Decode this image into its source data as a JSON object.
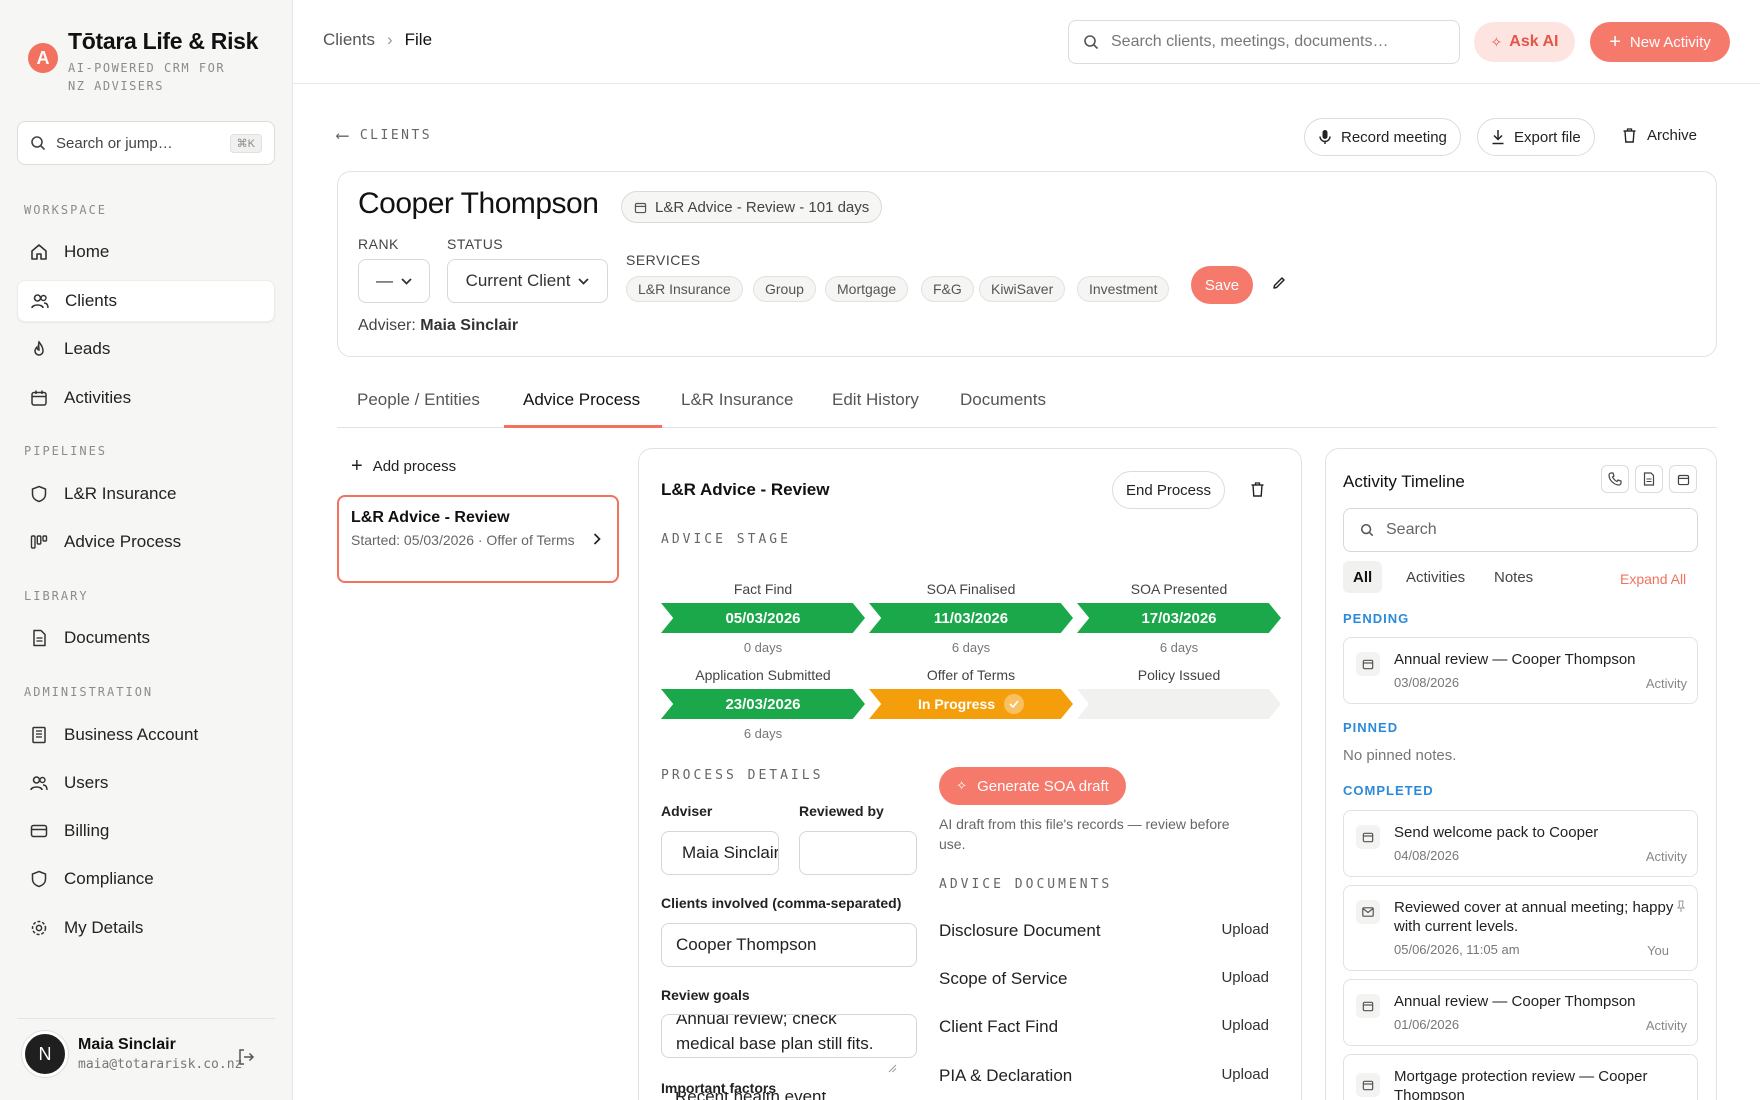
{
  "brand": {
    "logo_letter": "A",
    "title": "Tōtara Life & Risk",
    "subtitle": "AI-POWERED CRM FOR NZ ADVISERS"
  },
  "sidebar": {
    "search_placeholder": "Search or jump…",
    "search_shortcut": "⌘K",
    "sections": {
      "workspace": "WORKSPACE",
      "pipelines": "PIPELINES",
      "library": "LIBRARY",
      "administration": "ADMINISTRATION"
    },
    "items": {
      "home": "Home",
      "clients": "Clients",
      "leads": "Leads",
      "activities": "Activities",
      "lr_insurance": "L&R Insurance",
      "advice_process": "Advice Process",
      "documents": "Documents",
      "business_account": "Business Account",
      "users": "Users",
      "billing": "Billing",
      "compliance": "Compliance",
      "my_details": "My Details"
    },
    "user": {
      "initial": "N",
      "name": "Maia Sinclair",
      "email": "maia@totararisk.co.nz"
    }
  },
  "topbar": {
    "breadcrumb_root": "Clients",
    "breadcrumb_sep": "›",
    "breadcrumb_current": "File",
    "search_placeholder": "Search clients, meetings, documents…",
    "ask_ai": "Ask AI",
    "new_activity": "New Activity"
  },
  "page": {
    "back_label": "CLIENTS",
    "record_meeting": "Record meeting",
    "export_file": "Export file",
    "archive": "Archive"
  },
  "client": {
    "name": "Cooper Thompson",
    "process_badge": "L&R Advice - Review - 101 days",
    "rank_label": "RANK",
    "rank_value": "—",
    "status_label": "STATUS",
    "status_value": "Current Client",
    "services_label": "SERVICES",
    "services": [
      "L&R Insurance",
      "Group",
      "Mortgage",
      "F&G",
      "KiwiSaver",
      "Investment"
    ],
    "save": "Save",
    "adviser_prefix": "Adviser:",
    "adviser_name": "Maia Sinclair"
  },
  "tabs": [
    "People / Entities",
    "Advice Process",
    "L&R Insurance",
    "Edit History",
    "Documents"
  ],
  "processes": {
    "add_label": "Add process",
    "items": [
      {
        "title": "L&R Advice - Review",
        "subtitle": "Started: 05/03/2026 · Offer of Terms"
      }
    ]
  },
  "process_panel": {
    "title": "L&R Advice - Review",
    "end_process": "End Process",
    "advice_stage_cap": "ADVICE STAGE",
    "stages": [
      {
        "label": "Fact Find",
        "value": "05/03/2026",
        "days": "0 days",
        "state": "done"
      },
      {
        "label": "SOA Finalised",
        "value": "11/03/2026",
        "days": "6 days",
        "state": "done"
      },
      {
        "label": "SOA Presented",
        "value": "17/03/2026",
        "days": "6 days",
        "state": "done"
      },
      {
        "label": "Application Submitted",
        "value": "23/03/2026",
        "days": "6 days",
        "state": "done"
      },
      {
        "label": "Offer of Terms",
        "value": "In Progress",
        "days": "",
        "state": "progress"
      },
      {
        "label": "Policy Issued",
        "value": "",
        "days": "",
        "state": "empty"
      }
    ],
    "process_details_cap": "PROCESS DETAILS",
    "adviser_label": "Adviser",
    "adviser_value": "Maia Sinclair",
    "reviewed_by_label": "Reviewed by",
    "reviewed_by_value": "",
    "clients_involved_label": "Clients involved (comma-separated)",
    "clients_involved_value": "Cooper Thompson",
    "review_goals_label": "Review goals",
    "review_goals_line1": "Annual review; check",
    "review_goals_line2": "medical base plan still fits.",
    "important_factors_label": "Important factors",
    "important_factors_value": "Recent health event",
    "generate_soa": "Generate SOA draft",
    "ai_note": "AI draft from this file's records — review before use.",
    "advice_documents_cap": "ADVICE DOCUMENTS",
    "upload_label": "Upload",
    "documents": [
      "Disclosure Document",
      "Scope of Service",
      "Client Fact Find",
      "PIA & Declaration"
    ]
  },
  "timeline": {
    "title": "Activity Timeline",
    "search_placeholder": "Search",
    "filters": [
      "All",
      "Activities",
      "Notes"
    ],
    "expand_all": "Expand All",
    "pending_label": "PENDING",
    "pinned_label": "PINNED",
    "no_pinned": "No pinned notes.",
    "completed_label": "COMPLETED",
    "pending": [
      {
        "title": "Annual review — Cooper Thompson",
        "date": "03/08/2026",
        "kind": "Activity"
      }
    ],
    "completed": [
      {
        "title": "Send welcome pack to Cooper",
        "date": "04/08/2026",
        "kind": "Activity"
      },
      {
        "title": "Reviewed cover at annual meeting; happy with current levels.",
        "date": "05/06/2026, 11:05 am",
        "kind": "You"
      },
      {
        "title": "Annual review — Cooper Thompson",
        "date": "01/06/2026",
        "kind": "Activity"
      },
      {
        "title": "Mortgage protection review — Cooper Thompson",
        "date": "",
        "kind": ""
      }
    ]
  },
  "colors": {
    "accent": "#f2715f",
    "stage_done": "#1aa84b",
    "stage_progress": "#f59e0b",
    "timeline_section": "#2b8ad9"
  }
}
